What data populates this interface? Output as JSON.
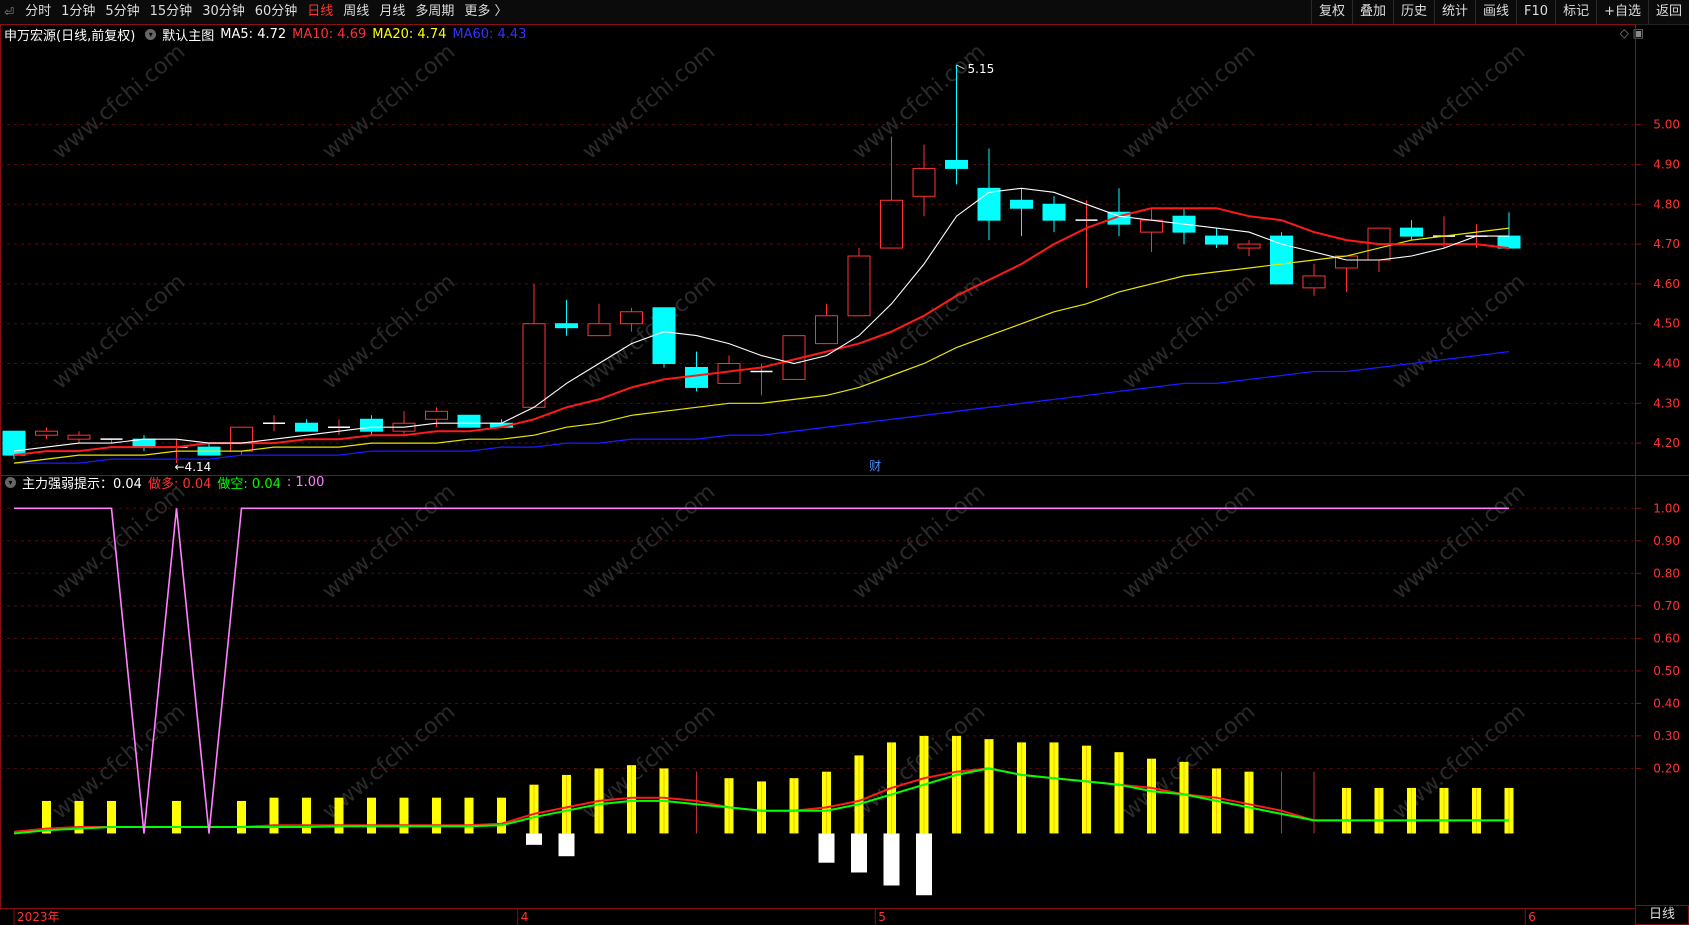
{
  "toolbar": {
    "back": "⏎",
    "periods": [
      "分时",
      "1分钟",
      "5分钟",
      "15分钟",
      "30分钟",
      "60分钟",
      "日线",
      "周线",
      "月线",
      "多周期",
      "更多 〉"
    ],
    "active_period": "日线",
    "right": [
      "复权",
      "叠加",
      "历史",
      "统计",
      "画线",
      "F10",
      "标记",
      "+自选",
      "返回"
    ]
  },
  "main_info": {
    "stock": "申万宏源(日线,前复权)",
    "template": "默认主图",
    "ma5": "MA5: 4.72",
    "ma10": "MA10: 4.69",
    "ma20": "MA20: 4.74",
    "ma60": "MA60: 4.43"
  },
  "sub_info": {
    "name": "主力强弱提示：0.04",
    "zuoduo": "做多: 0.04",
    "zuokong": "做空: 0.04",
    "extra": ": 1.00"
  },
  "annotations": {
    "high": "5.15",
    "low": "4.14",
    "cai": "财"
  },
  "axis": {
    "main_ticks": [
      "5.00",
      "4.90",
      "4.80",
      "4.70",
      "4.60",
      "4.50",
      "4.40",
      "4.30",
      "4.20"
    ],
    "sub_ticks": [
      "1.00",
      "0.90",
      "0.80",
      "0.70",
      "0.60",
      "0.50",
      "0.40",
      "0.30",
      "0.20"
    ],
    "date_labels": [
      "2023年",
      "4",
      "5",
      "6"
    ]
  },
  "status": "日线",
  "watermark": "www.cfchi.com",
  "colors": {
    "up": "#ff3232",
    "down": "#00ffff",
    "ma5": "#ffffff",
    "ma10": "#ff1a1a",
    "ma20": "#e6e600",
    "ma60": "#1a1aff",
    "purple": "#ff80ff",
    "bar_yellow": "#ffff00",
    "green": "#00ff00"
  },
  "chart_data": {
    "type": "candlestick",
    "ohlc": [
      [
        4.23,
        4.23,
        4.16,
        4.17
      ],
      [
        4.22,
        4.24,
        4.21,
        4.23
      ],
      [
        4.21,
        4.23,
        4.2,
        4.22
      ],
      [
        4.21,
        4.21,
        4.2,
        4.21
      ],
      [
        4.21,
        4.22,
        4.18,
        4.19
      ],
      [
        4.19,
        4.21,
        4.15,
        4.19
      ],
      [
        4.19,
        4.2,
        4.17,
        4.17
      ],
      [
        4.18,
        4.24,
        4.17,
        4.24
      ],
      [
        4.25,
        4.27,
        4.23,
        4.25
      ],
      [
        4.25,
        4.26,
        4.23,
        4.23
      ],
      [
        4.24,
        4.26,
        4.22,
        4.24
      ],
      [
        4.26,
        4.27,
        4.22,
        4.23
      ],
      [
        4.23,
        4.28,
        4.22,
        4.25
      ],
      [
        4.26,
        4.29,
        4.24,
        4.28
      ],
      [
        4.27,
        4.27,
        4.24,
        4.24
      ],
      [
        4.25,
        4.26,
        4.24,
        4.24
      ],
      [
        4.29,
        4.6,
        4.29,
        4.5
      ],
      [
        4.5,
        4.56,
        4.47,
        4.49
      ],
      [
        4.47,
        4.55,
        4.47,
        4.5
      ],
      [
        4.5,
        4.54,
        4.48,
        4.53
      ],
      [
        4.54,
        4.54,
        4.39,
        4.4
      ],
      [
        4.39,
        4.43,
        4.33,
        4.34
      ],
      [
        4.35,
        4.42,
        4.35,
        4.4
      ],
      [
        4.38,
        4.4,
        4.32,
        4.38
      ],
      [
        4.36,
        4.47,
        4.36,
        4.47
      ],
      [
        4.45,
        4.55,
        4.45,
        4.52
      ],
      [
        4.52,
        4.69,
        4.52,
        4.67
      ],
      [
        4.69,
        4.97,
        4.69,
        4.81
      ],
      [
        4.82,
        4.95,
        4.77,
        4.89
      ],
      [
        4.91,
        5.15,
        4.85,
        4.89
      ],
      [
        4.84,
        4.94,
        4.71,
        4.76
      ],
      [
        4.81,
        4.84,
        4.72,
        4.79
      ],
      [
        4.8,
        4.82,
        4.73,
        4.76
      ],
      [
        4.76,
        4.81,
        4.59,
        4.76
      ],
      [
        4.78,
        4.84,
        4.72,
        4.75
      ],
      [
        4.73,
        4.79,
        4.68,
        4.76
      ],
      [
        4.77,
        4.79,
        4.7,
        4.73
      ],
      [
        4.72,
        4.74,
        4.69,
        4.7
      ],
      [
        4.69,
        4.71,
        4.67,
        4.7
      ],
      [
        4.72,
        4.73,
        4.6,
        4.6
      ],
      [
        4.59,
        4.65,
        4.57,
        4.62
      ],
      [
        4.64,
        4.67,
        4.58,
        4.67
      ],
      [
        4.66,
        4.74,
        4.63,
        4.74
      ],
      [
        4.74,
        4.76,
        4.71,
        4.72
      ],
      [
        4.72,
        4.77,
        4.69,
        4.72
      ],
      [
        4.72,
        4.75,
        4.69,
        4.72
      ],
      [
        4.72,
        4.78,
        4.69,
        4.69
      ]
    ],
    "ma5": [
      4.18,
      4.19,
      4.2,
      4.2,
      4.21,
      4.21,
      4.2,
      4.2,
      4.21,
      4.22,
      4.23,
      4.24,
      4.24,
      4.25,
      4.25,
      4.25,
      4.29,
      4.35,
      4.4,
      4.45,
      4.48,
      4.47,
      4.45,
      4.42,
      4.4,
      4.42,
      4.47,
      4.55,
      4.65,
      4.77,
      4.83,
      4.84,
      4.83,
      4.8,
      4.77,
      4.76,
      4.75,
      4.74,
      4.73,
      4.7,
      4.68,
      4.66,
      4.66,
      4.67,
      4.69,
      4.72,
      4.72
    ],
    "ma10": [
      4.17,
      4.18,
      4.18,
      4.19,
      4.19,
      4.19,
      4.2,
      4.2,
      4.2,
      4.21,
      4.21,
      4.22,
      4.22,
      4.23,
      4.23,
      4.24,
      4.26,
      4.29,
      4.31,
      4.34,
      4.36,
      4.37,
      4.38,
      4.39,
      4.41,
      4.43,
      4.45,
      4.48,
      4.52,
      4.57,
      4.61,
      4.65,
      4.7,
      4.74,
      4.77,
      4.79,
      4.79,
      4.79,
      4.77,
      4.76,
      4.73,
      4.71,
      4.7,
      4.7,
      4.7,
      4.7,
      4.69
    ],
    "ma20": [
      4.15,
      4.16,
      4.17,
      4.17,
      4.17,
      4.18,
      4.18,
      4.18,
      4.19,
      4.19,
      4.19,
      4.2,
      4.2,
      4.2,
      4.21,
      4.21,
      4.22,
      4.24,
      4.25,
      4.27,
      4.28,
      4.29,
      4.3,
      4.3,
      4.31,
      4.32,
      4.34,
      4.37,
      4.4,
      4.44,
      4.47,
      4.5,
      4.53,
      4.55,
      4.58,
      4.6,
      4.62,
      4.63,
      4.64,
      4.65,
      4.66,
      4.67,
      4.69,
      4.71,
      4.72,
      4.73,
      4.74
    ],
    "ma60": [
      4.15,
      4.15,
      4.15,
      4.16,
      4.16,
      4.16,
      4.16,
      4.17,
      4.17,
      4.17,
      4.17,
      4.18,
      4.18,
      4.18,
      4.18,
      4.19,
      4.19,
      4.2,
      4.2,
      4.21,
      4.21,
      4.21,
      4.22,
      4.22,
      4.23,
      4.24,
      4.25,
      4.26,
      4.27,
      4.28,
      4.29,
      4.3,
      4.31,
      4.32,
      4.33,
      4.34,
      4.35,
      4.35,
      4.36,
      4.37,
      4.38,
      4.38,
      4.39,
      4.4,
      4.41,
      4.42,
      4.43
    ],
    "purple": [
      1,
      1,
      1,
      1,
      0,
      1,
      0,
      1,
      1,
      1,
      1,
      1,
      1,
      1,
      1,
      1,
      1,
      1,
      1,
      1,
      1,
      1,
      1,
      1,
      1,
      1,
      1,
      1,
      1,
      1,
      1,
      1,
      1,
      1,
      1,
      1,
      1,
      1,
      1,
      1,
      1,
      1,
      1,
      1,
      1,
      1,
      1
    ],
    "yellow_bars": [
      0,
      0.1,
      0.1,
      0.1,
      0,
      0.1,
      0,
      0.1,
      0.11,
      0.11,
      0.11,
      0.11,
      0.11,
      0.11,
      0.11,
      0.11,
      0.15,
      0.18,
      0.2,
      0.21,
      0.2,
      0,
      0.17,
      0.16,
      0.17,
      0.19,
      0.24,
      0.28,
      0.3,
      0.3,
      0.29,
      0.28,
      0.28,
      0.27,
      0.25,
      0.23,
      0.22,
      0.2,
      0.19,
      0,
      0,
      0.14,
      0.14,
      0.14,
      0.14,
      0.14,
      0.14
    ],
    "white_bars": [
      0,
      0,
      0,
      0,
      0,
      0,
      0,
      0,
      0,
      0,
      0,
      0,
      0,
      0,
      0,
      0,
      -0.035,
      -0.07,
      0,
      0,
      0,
      0,
      0,
      0,
      0,
      -0.09,
      -0.12,
      -0.16,
      -0.19,
      0,
      0,
      0,
      0,
      0,
      0,
      0,
      0,
      0,
      0,
      0,
      0,
      0,
      0,
      0,
      0,
      0,
      0
    ],
    "red_line": [
      0.005,
      0.015,
      0.02,
      0.02,
      0.02,
      0.02,
      0.02,
      0.02,
      0.025,
      0.025,
      0.025,
      0.025,
      0.025,
      0.025,
      0.025,
      0.03,
      0.06,
      0.08,
      0.1,
      0.11,
      0.11,
      0.1,
      0.08,
      0.07,
      0.07,
      0.08,
      0.1,
      0.14,
      0.17,
      0.19,
      0.2,
      0.18,
      0.17,
      0.16,
      0.15,
      0.14,
      0.12,
      0.11,
      0.09,
      0.07,
      0.04,
      0.04,
      0.04,
      0.04,
      0.04,
      0.04,
      0.04
    ],
    "green_line": [
      0.0,
      0.01,
      0.015,
      0.02,
      0.02,
      0.02,
      0.02,
      0.02,
      0.02,
      0.02,
      0.022,
      0.022,
      0.022,
      0.022,
      0.022,
      0.025,
      0.05,
      0.07,
      0.09,
      0.1,
      0.1,
      0.09,
      0.08,
      0.07,
      0.07,
      0.07,
      0.09,
      0.12,
      0.15,
      0.18,
      0.2,
      0.18,
      0.17,
      0.16,
      0.15,
      0.13,
      0.12,
      0.1,
      0.08,
      0.06,
      0.04,
      0.04,
      0.04,
      0.04,
      0.04,
      0.04,
      0.04
    ],
    "main_range": [
      4.12,
      5.2
    ],
    "sub_range": [
      -0.22,
      1.05
    ]
  }
}
